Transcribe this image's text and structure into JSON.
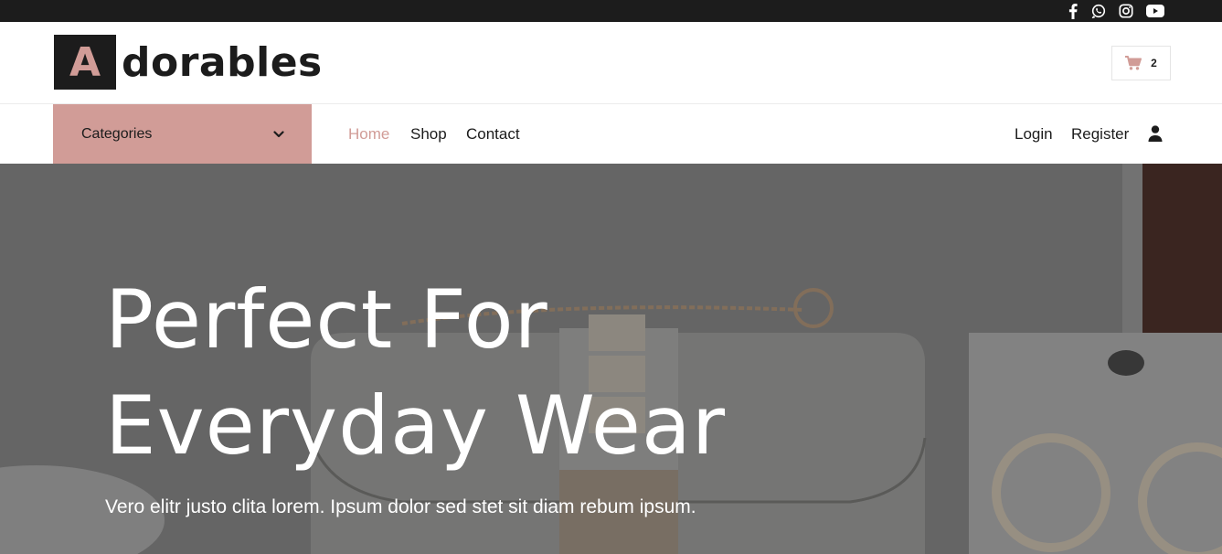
{
  "topbar": {
    "social": [
      "facebook-icon",
      "whatsapp-icon",
      "instagram-icon",
      "youtube-icon"
    ]
  },
  "header": {
    "logo_letter": "A",
    "logo_text": "dorables",
    "cart_count": "2"
  },
  "nav": {
    "categories_label": "Categories",
    "links": [
      {
        "label": "Home",
        "active": true
      },
      {
        "label": "Shop",
        "active": false
      },
      {
        "label": "Contact",
        "active": false
      }
    ],
    "login_label": "Login",
    "register_label": "Register"
  },
  "hero": {
    "title_line1": "Perfect For",
    "title_line2": "Everyday Wear",
    "subtitle": "Vero elitr justo clita lorem. Ipsum dolor sed stet sit diam rebum ipsum."
  },
  "colors": {
    "accent": "#d19c97",
    "dark": "#1c1c1c",
    "white": "#ffffff"
  }
}
